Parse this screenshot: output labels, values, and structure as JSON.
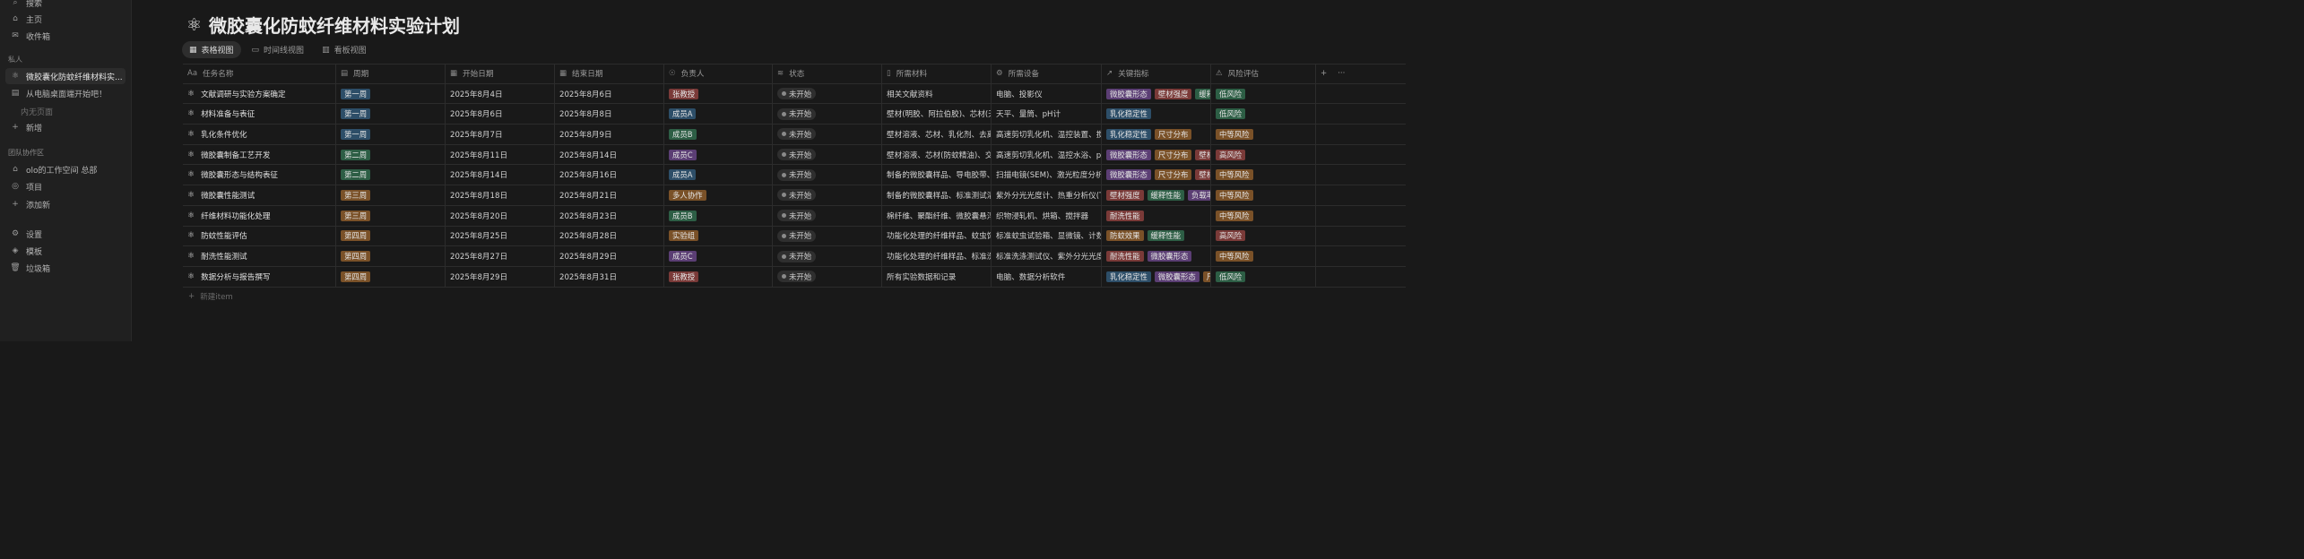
{
  "sidebar": {
    "top": [
      {
        "name": "search",
        "icon": "search-icon",
        "glyph": "⌕",
        "label": "搜索"
      },
      {
        "name": "home",
        "icon": "home-icon",
        "glyph": "⌂",
        "label": "主页"
      },
      {
        "name": "inbox",
        "icon": "inbox-icon",
        "glyph": "✉",
        "label": "收件箱"
      }
    ],
    "private_heading": "私人",
    "private": [
      {
        "name": "page-microcapsule",
        "icon": "atom-icon",
        "glyph": "⚛",
        "label": "微胶囊化防蚊纤维材料实...",
        "active": true
      },
      {
        "name": "page-desktop-start",
        "icon": "page-icon",
        "glyph": "▤",
        "label": "从电脑桌面端开始吧！"
      }
    ],
    "no_pages": "内无页面",
    "new_label": "新增",
    "team_heading": "团队协作区",
    "team": [
      {
        "name": "workspace-olo",
        "icon": "home-icon",
        "glyph": "⌂",
        "label": "olo的工作空间 总部"
      },
      {
        "name": "projects",
        "icon": "projects-icon",
        "glyph": "◎",
        "label": "项目"
      },
      {
        "name": "add-new",
        "icon": "plus-icon",
        "glyph": "+",
        "label": "添加新"
      }
    ],
    "bottom": [
      {
        "name": "settings",
        "icon": "gear-icon",
        "glyph": "⚙",
        "label": "设置"
      },
      {
        "name": "templates",
        "icon": "template-icon",
        "glyph": "◈",
        "label": "模板"
      },
      {
        "name": "trash",
        "icon": "trash-icon",
        "glyph": "🗑",
        "label": "垃圾箱"
      }
    ]
  },
  "page": {
    "title": "微胶囊化防蚊纤维材料实验计划",
    "title_icon": "⚛",
    "tabs": [
      {
        "name": "tab-table",
        "icon": "table-icon",
        "glyph": "▦",
        "label": "表格视图",
        "active": true
      },
      {
        "name": "tab-timeline",
        "icon": "timeline-icon",
        "glyph": "▭",
        "label": "时间线视图"
      },
      {
        "name": "tab-board",
        "icon": "board-icon",
        "glyph": "▥",
        "label": "看板视图"
      }
    ]
  },
  "table": {
    "headers": [
      {
        "icon": "text-icon",
        "glyph": "Aa",
        "label": "任务名称"
      },
      {
        "icon": "select-icon",
        "glyph": "▤",
        "label": "周期"
      },
      {
        "icon": "calendar-icon",
        "glyph": "▦",
        "label": "开始日期"
      },
      {
        "icon": "calendar-icon",
        "glyph": "▦",
        "label": "结束日期"
      },
      {
        "icon": "person-icon",
        "glyph": "☉",
        "label": "负责人"
      },
      {
        "icon": "status-icon",
        "glyph": "≋",
        "label": "状态"
      },
      {
        "icon": "materials-icon",
        "glyph": "▯",
        "label": "所需材料"
      },
      {
        "icon": "equipment-icon",
        "glyph": "⚙",
        "label": "所需设备"
      },
      {
        "icon": "chart-icon",
        "glyph": "↗",
        "label": "关键指标"
      },
      {
        "icon": "warning-icon",
        "glyph": "⚠",
        "label": "风险评估"
      }
    ],
    "add_column": "+",
    "more": "···",
    "rows": [
      {
        "task": "文献调研与实验方案确定",
        "period": {
          "label": "第一周",
          "color": "#2d4e68"
        },
        "start": "2025年8月4日",
        "end": "2025年8月6日",
        "owner": {
          "label": "张教授",
          "color": "#7a3a38"
        },
        "status": "未开始",
        "materials": "相关文献资料",
        "equipment": "电脑、投影仪",
        "metrics": [
          {
            "label": "微胶囊形态",
            "color": "#5b3e74"
          },
          {
            "label": "壁材强度",
            "color": "#7a3a38"
          },
          {
            "label": "缓释性能",
            "color": "#2d5e45"
          }
        ],
        "risk": {
          "label": "低风险",
          "color": "#2d5e45"
        }
      },
      {
        "task": "材料准备与表征",
        "period": {
          "label": "第一周",
          "color": "#2d4e68"
        },
        "start": "2025年8月6日",
        "end": "2025年8月8日",
        "owner": {
          "label": "成员A",
          "color": "#2d4e68"
        },
        "status": "未开始",
        "materials": "壁材(明胶、阿拉伯胶)、芯材(天然驱蚊剂)",
        "equipment": "天平、量筒、pH计",
        "metrics": [
          {
            "label": "乳化稳定性",
            "color": "#2d4e68"
          }
        ],
        "risk": {
          "label": "低风险",
          "color": "#2d5e45"
        }
      },
      {
        "task": "乳化条件优化",
        "period": {
          "label": "第一周",
          "color": "#2d4e68"
        },
        "start": "2025年8月7日",
        "end": "2025年8月9日",
        "owner": {
          "label": "成员B",
          "color": "#2d5e45"
        },
        "status": "未开始",
        "materials": "壁材溶液、芯材、乳化剂、去离子水",
        "equipment": "高速剪切乳化机、温控装置、搅拌器",
        "metrics": [
          {
            "label": "乳化稳定性",
            "color": "#2d4e68"
          },
          {
            "label": "尺寸分布",
            "color": "#7a5128"
          }
        ],
        "risk": {
          "label": "中等风险",
          "color": "#7a5128"
        }
      },
      {
        "task": "微胶囊制备工艺开发",
        "period": {
          "label": "第二周",
          "color": "#2d5e45"
        },
        "start": "2025年8月11日",
        "end": "2025年8月14日",
        "owner": {
          "label": "成员C",
          "color": "#5b3e74"
        },
        "status": "未开始",
        "materials": "壁材溶液、芯材(防蚊精油)、交联剂",
        "equipment": "高速剪切乳化机、温控水浴、pH计",
        "metrics": [
          {
            "label": "微胶囊形态",
            "color": "#5b3e74"
          },
          {
            "label": "尺寸分布",
            "color": "#7a5128"
          },
          {
            "label": "壁材强度",
            "color": "#7a3a38"
          }
        ],
        "risk": {
          "label": "高风险",
          "color": "#7a3a38"
        }
      },
      {
        "task": "微胶囊形态与结构表征",
        "period": {
          "label": "第二周",
          "color": "#2d5e45"
        },
        "start": "2025年8月14日",
        "end": "2025年8月16日",
        "owner": {
          "label": "成员A",
          "color": "#2d4e68"
        },
        "status": "未开始",
        "materials": "制备的微胶囊样品、导电胶带、载玻片",
        "equipment": "扫描电镜(SEM)、激光粒度分析仪",
        "metrics": [
          {
            "label": "微胶囊形态",
            "color": "#5b3e74"
          },
          {
            "label": "尺寸分布",
            "color": "#7a5128"
          },
          {
            "label": "壁材强度",
            "color": "#7a3a38"
          }
        ],
        "risk": {
          "label": "中等风险",
          "color": "#7a5128"
        }
      },
      {
        "task": "微胶囊性能测试",
        "period": {
          "label": "第三周",
          "color": "#7a5128"
        },
        "start": "2025年8月18日",
        "end": "2025年8月21日",
        "owner": {
          "label": "多人协作",
          "color": "#7a5128"
        },
        "status": "未开始",
        "materials": "制备的微胶囊样品、标准测试溶液",
        "equipment": "紫外分光光度计、热重分析仪(TGA)",
        "metrics": [
          {
            "label": "壁材强度",
            "color": "#7a3a38"
          },
          {
            "label": "缓释性能",
            "color": "#2d5e45"
          },
          {
            "label": "负载率",
            "color": "#5b3e74"
          }
        ],
        "risk": {
          "label": "中等风险",
          "color": "#7a5128"
        }
      },
      {
        "task": "纤维材料功能化处理",
        "period": {
          "label": "第三周",
          "color": "#7a5128"
        },
        "start": "2025年8月20日",
        "end": "2025年8月23日",
        "owner": {
          "label": "成员B",
          "color": "#2d5e45"
        },
        "status": "未开始",
        "materials": "棉纤维、聚酯纤维、微胶囊悬浮液",
        "equipment": "织物浸轧机、烘箱、搅拌器",
        "metrics": [
          {
            "label": "耐洗性能",
            "color": "#7a3a38"
          }
        ],
        "risk": {
          "label": "中等风险",
          "color": "#7a5128"
        }
      },
      {
        "task": "防蚊性能评估",
        "period": {
          "label": "第四周",
          "color": "#7a5128"
        },
        "start": "2025年8月25日",
        "end": "2025年8月28日",
        "owner": {
          "label": "实验组",
          "color": "#7a5128"
        },
        "status": "未开始",
        "materials": "功能化处理的纤维样品、蚊虫饲养箱",
        "equipment": "标准蚊虫试验箱、显微镜、计数器",
        "metrics": [
          {
            "label": "防蚊效果",
            "color": "#7a5128"
          },
          {
            "label": "缓释性能",
            "color": "#2d5e45"
          }
        ],
        "risk": {
          "label": "高风险",
          "color": "#7a3a38"
        }
      },
      {
        "task": "耐洗性能测试",
        "period": {
          "label": "第四周",
          "color": "#7a5128"
        },
        "start": "2025年8月27日",
        "end": "2025年8月29日",
        "owner": {
          "label": "成员C",
          "color": "#5b3e74"
        },
        "status": "未开始",
        "materials": "功能化处理的纤维样品、标准洗涤剂",
        "equipment": "标准洗涤测试仪、紫外分光光度计",
        "metrics": [
          {
            "label": "耐洗性能",
            "color": "#7a3a38"
          },
          {
            "label": "微胶囊形态",
            "color": "#5b3e74"
          }
        ],
        "risk": {
          "label": "中等风险",
          "color": "#7a5128"
        }
      },
      {
        "task": "数据分析与报告撰写",
        "period": {
          "label": "第四周",
          "color": "#7a5128"
        },
        "start": "2025年8月29日",
        "end": "2025年8月31日",
        "owner": {
          "label": "张教授",
          "color": "#7a3a38"
        },
        "status": "未开始",
        "materials": "所有实验数据和记录",
        "equipment": "电脑、数据分析软件",
        "metrics": [
          {
            "label": "乳化稳定性",
            "color": "#2d4e68"
          },
          {
            "label": "微胶囊形态",
            "color": "#5b3e74"
          },
          {
            "label": "尺寸分布",
            "color": "#7a5128"
          }
        ],
        "risk": {
          "label": "低风险",
          "color": "#2d5e45"
        }
      }
    ],
    "new_item": "新建item"
  }
}
